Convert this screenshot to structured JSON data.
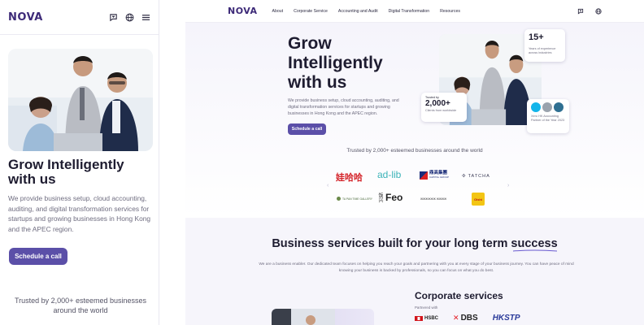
{
  "brand": {
    "logo": "NOVA",
    "accent": "#5b4fa8",
    "logo_color": "#3d2a78"
  },
  "mobile": {
    "icons": [
      "chat-heart-icon",
      "globe-icon",
      "menu-icon"
    ],
    "hero_title": "Grow Intelligently with us",
    "hero_desc": "We provide business setup, cloud accounting, auditing, and digital transformation services for startups and growing businesses in Hong Kong and the APEC region.",
    "cta": "Schedule a call",
    "trusted": "Trusted by 2,000+ esteemed businesses around the world"
  },
  "desktop": {
    "nav": [
      "About",
      "Corporate Service",
      "Accounting and Audit",
      "Digital Transformation",
      "Resources"
    ],
    "hero_title": "Grow Intelligently with us",
    "hero_desc": "We provide business setup, cloud accounting, auditing, and digital transformation services for startups and growing businesses in Hong Kong and the APEC region.",
    "cta": "Schedule a call",
    "stat_experience": {
      "num": "15+",
      "label": "Years of experience across industries"
    },
    "stat_clients": {
      "top": "Trusted by",
      "num": "2,000+",
      "label": "Clients from worldwide"
    },
    "award": {
      "label": "Xero HK Accounting Partner of the Year 2023",
      "badge": "xero"
    },
    "trusted": "Trusted by 2,000+ esteemed businesses around the world",
    "client_logos": {
      "wahaha": "娃哈哈",
      "adlib": "ad-lib",
      "capital": "鼎高集團",
      "capital_sub": "CAPITAL GROUP",
      "tatcha": "TATCHA",
      "small1": "TA PAN TIME GALLERY",
      "feo": "Feo",
      "feo_cn": "饭兴",
      "small3": "ЖЖЖЖЖЖ ЖЖЖЖ",
      "yellow": "Oishi"
    },
    "services_title": "Business services built for your long term success",
    "services_desc": "We are a business enabler. Our dedicated team focuses on helping you reach your goals and partnering with you at every stage of your business journey. You can have peace of mind knowing your business is backed by professionals, so you can focus on what you do best.",
    "corporate_title": "Corporate services",
    "partnered_with": "Partnered with",
    "partners": [
      "HSBC",
      "DBS",
      "HKSTP"
    ]
  }
}
